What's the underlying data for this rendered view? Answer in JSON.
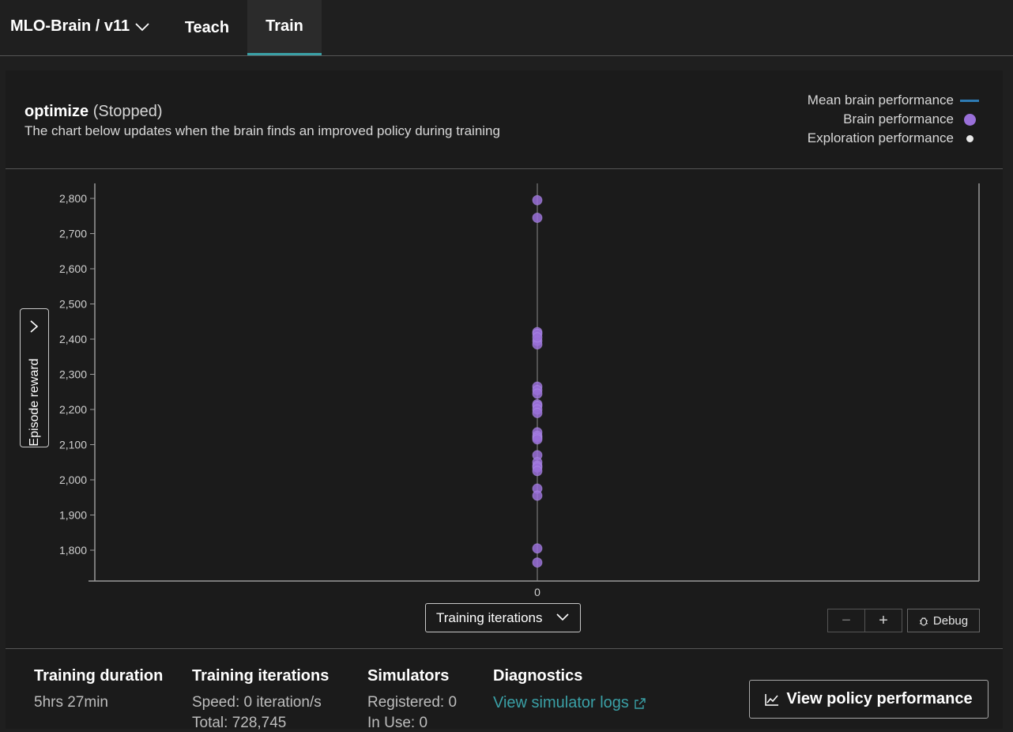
{
  "nav": {
    "brain_title": "MLO-Brain / v11",
    "tabs": [
      {
        "label": "Teach",
        "active": false
      },
      {
        "label": "Train",
        "active": true
      }
    ]
  },
  "header": {
    "concept_name": "optimize",
    "status": "(Stopped)",
    "subtitle": "The chart below updates when the brain finds an improved policy during training"
  },
  "legend": {
    "items": [
      {
        "label": "Mean brain performance",
        "color": "#2e7bb4",
        "swatch": "line"
      },
      {
        "label": "Brain performance",
        "color": "#9a70d9",
        "swatch": "dot"
      },
      {
        "label": "Exploration performance",
        "color": "#e8e8e8",
        "swatch": "small-dot"
      }
    ]
  },
  "controls": {
    "y_axis_label": "Episode reward",
    "x_axis_selector": "Training iterations",
    "zoom_out_icon": "minus-icon",
    "zoom_in_icon": "plus-icon",
    "debug_label": "Debug"
  },
  "chart_data": {
    "type": "scatter",
    "title": "",
    "xlabel": "Training iterations",
    "ylabel": "Episode reward",
    "x_ticks": [
      "0"
    ],
    "y_ticks": [
      "1,800",
      "1,900",
      "2,000",
      "2,100",
      "2,200",
      "2,300",
      "2,400",
      "2,500",
      "2,600",
      "2,700",
      "2,800"
    ],
    "ylim": [
      1710,
      2840
    ],
    "grid": false,
    "legend_position": "top-right",
    "series": [
      {
        "name": "Brain performance",
        "color": "#9a70d9",
        "x": [
          0,
          0,
          0,
          0,
          0,
          0,
          0,
          0,
          0,
          0,
          0,
          0,
          0,
          0,
          0,
          0,
          0,
          0,
          0,
          0,
          0,
          0,
          0,
          0,
          0,
          0,
          0
        ],
        "y": [
          2795,
          2745,
          2420,
          2415,
          2395,
          2385,
          2265,
          2255,
          2245,
          2215,
          2210,
          2200,
          2190,
          2135,
          2125,
          2120,
          2115,
          2070,
          2050,
          2040,
          2035,
          2025,
          1975,
          1955,
          1805,
          1765,
          2405
        ]
      }
    ]
  },
  "stats": {
    "duration": {
      "title": "Training duration",
      "value": "5hrs 27min"
    },
    "iterations": {
      "title": "Training iterations",
      "speed": "Speed: 0 iteration/s",
      "total": "Total: 728,745"
    },
    "simulators": {
      "title": "Simulators",
      "registered": "Registered: 0",
      "in_use": "In Use: 0"
    },
    "diagnostics": {
      "title": "Diagnostics",
      "link": "View simulator logs"
    },
    "view_policy_button": "View policy performance"
  }
}
